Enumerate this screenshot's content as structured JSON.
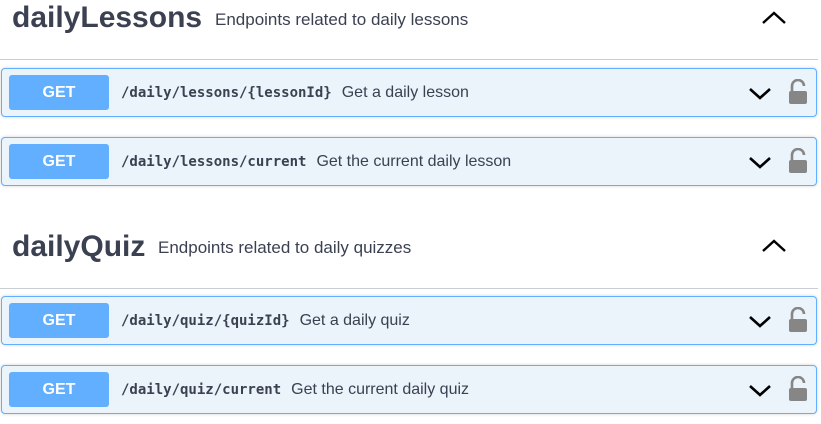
{
  "sections": [
    {
      "title": "dailyLessons",
      "description": "Endpoints related to daily lessons",
      "operations": [
        {
          "method": "GET",
          "path": "/daily/lessons/{lessonId}",
          "summary": "Get a daily lesson"
        },
        {
          "method": "GET",
          "path": "/daily/lessons/current",
          "summary": "Get the current daily lesson"
        }
      ]
    },
    {
      "title": "dailyQuiz",
      "description": "Endpoints related to daily quizzes",
      "operations": [
        {
          "method": "GET",
          "path": "/daily/quiz/{quizId}",
          "summary": "Get a daily quiz"
        },
        {
          "method": "GET",
          "path": "/daily/quiz/current",
          "summary": "Get the current daily quiz"
        }
      ]
    }
  ],
  "colors": {
    "get_accent": "#61affe",
    "get_background": "#ebf3fb",
    "text": "#3b4151",
    "icon": "#868686"
  },
  "icons": {
    "collapse": "chevron-up-icon",
    "expand": "chevron-down-icon",
    "auth": "unlocked-padlock-icon"
  }
}
